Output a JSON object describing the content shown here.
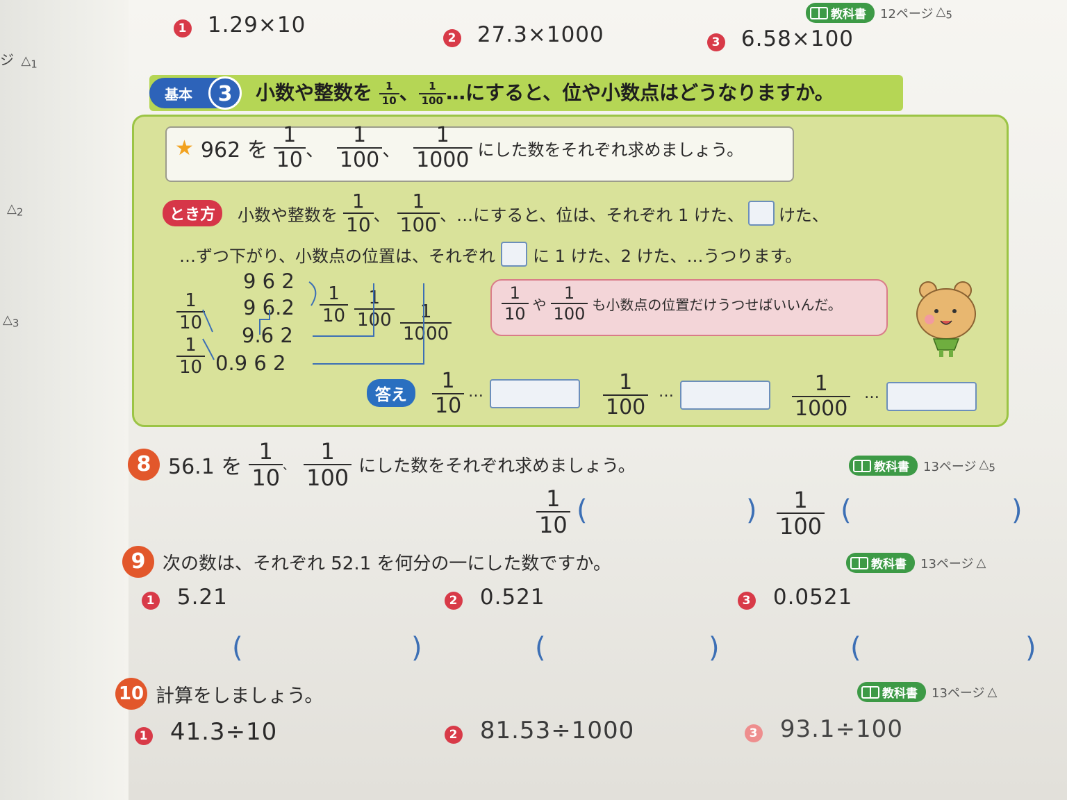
{
  "top_section": {
    "items": [
      {
        "num": "1",
        "expr": "1.29×10"
      },
      {
        "num": "2",
        "expr": "27.3×1000"
      },
      {
        "num": "3",
        "expr": "6.58×100"
      }
    ],
    "textbook_label": "教科書",
    "textbook_page": "12ページ",
    "textbook_mark": "5"
  },
  "basic3": {
    "badge_label": "基本",
    "badge_num": "3",
    "heading_prefix": "小数や整数を",
    "heading_suffix": "…にすると、位や小数点はどうなりますか。",
    "question_prefix": "962 を",
    "question_suffix": "にした数をそれぞれ求めましょう。",
    "tokikata_label": "とき方",
    "explain_line1_a": "小数や整数を",
    "explain_line1_b": "、…にすると、位は、それぞれ 1 けた、",
    "explain_line1_c": "けた、",
    "explain_line2_a": "…ずつ下がり、小数点の位置は、それぞれ",
    "explain_line2_b": "に 1 けた、2 けた、…うつります。",
    "bubble_mid": "や",
    "bubble_text": "も小数点の位置だけうつせばいいんだ。",
    "kotae_label": "答え",
    "ellipsis": "…"
  },
  "fractions": {
    "one": "1",
    "ten": "10",
    "hundred": "100",
    "thousand": "1000"
  },
  "diagram": {
    "rows": [
      "9 6 2",
      "9 6.2",
      "9.6 2",
      "0.9 6 2"
    ]
  },
  "q8": {
    "num": "8",
    "prefix": "56.1 を",
    "suffix": "にした数をそれぞれ求めましょう。",
    "textbook_page": "13ページ",
    "textbook_mark": "5"
  },
  "q9": {
    "num": "9",
    "text": "次の数は、それぞれ 52.1 を何分の一にした数ですか。",
    "textbook_page": "13ページ",
    "items": [
      {
        "num": "1",
        "value": "5.21"
      },
      {
        "num": "2",
        "value": "0.521"
      },
      {
        "num": "3",
        "value": "0.0521"
      }
    ]
  },
  "q10": {
    "num": "10",
    "text": "計算をしましょう。",
    "textbook_page": "13ページ",
    "items": [
      {
        "num": "1",
        "expr": "41.3÷10"
      },
      {
        "num": "2",
        "expr": "81.53÷1000"
      },
      {
        "num": "3",
        "expr": "93.1÷100"
      }
    ]
  },
  "left_margin": {
    "page_fragment": "ジ",
    "marks": [
      "1",
      "2",
      "3"
    ]
  },
  "parens": {
    "open": "(",
    "close": ")"
  },
  "colors": {
    "panel_bg": "#d9e29a",
    "panel_border": "#9bc445",
    "badge_blue": "#2d63b9",
    "tokikata_red": "#d63648",
    "number_red": "#d83a48",
    "textbook_green": "#3d9a46",
    "answer_blue": "#2a6fc0"
  }
}
